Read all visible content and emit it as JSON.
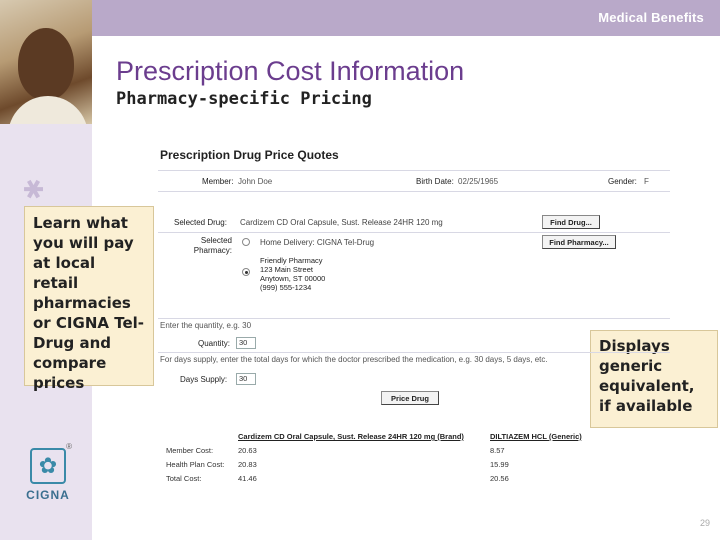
{
  "header": {
    "brand": "Medical Benefits"
  },
  "slide": {
    "title": "Prescription Cost Information",
    "subtitle": "Pharmacy-specific Pricing",
    "left_callout": "Learn what you will pay at local retail pharmacies or CIGNA Tel-Drug and compare prices",
    "right_callout": "Displays generic equivalent, if available",
    "logo_text": "CIGNA",
    "page_number": "29"
  },
  "quotes": {
    "heading": "Prescription Drug Price Quotes",
    "member_label": "Member:",
    "member_value": "John Doe",
    "birth_label": "Birth Date:",
    "birth_value": "02/25/1965",
    "gender_label": "Gender:",
    "gender_value": "F",
    "selected_drug_label": "Selected Drug:",
    "selected_drug_value": "Cardizem CD Oral Capsule, Sust. Release 24HR 120 mg",
    "find_drug_button": "Find Drug...",
    "selected_pharmacy_label": "Selected Pharmacy:",
    "option_home_delivery": "Home Delivery: CIGNA Tel-Drug",
    "find_pharmacy_button": "Find Pharmacy...",
    "pharmacy_name": "Friendly Pharmacy",
    "pharmacy_address": "123 Main Street",
    "pharmacy_city": "Anytown, ST 00000",
    "pharmacy_phone": "(999) 555-1234",
    "quantity_instruction": "Enter the quantity, e.g. 30",
    "quantity_label": "Quantity:",
    "quantity_value": "30",
    "days_instruction": "For days supply, enter the total days for which the doctor prescribed the medication, e.g. 30 days, 5 days, etc.",
    "days_label": "Days Supply:",
    "days_value": "30",
    "price_button": "Price Drug",
    "col_brand": "Cardizem CD Oral Capsule, Sust. Release 24HR 120 mg (Brand)",
    "col_generic": "DILTIAZEM HCL (Generic)",
    "rows": [
      {
        "label": "Member Cost:",
        "brand": "20.63",
        "generic": "8.57"
      },
      {
        "label": "Health Plan Cost:",
        "brand": "20.83",
        "generic": "15.99"
      },
      {
        "label": "Total Cost:",
        "brand": "41.46",
        "generic": "20.56"
      }
    ]
  },
  "colors": {
    "title": "#6b3d8e",
    "top_band": "#b9a9c9",
    "left_band": "#e9e2ef",
    "callout": "#fbf0d3"
  }
}
